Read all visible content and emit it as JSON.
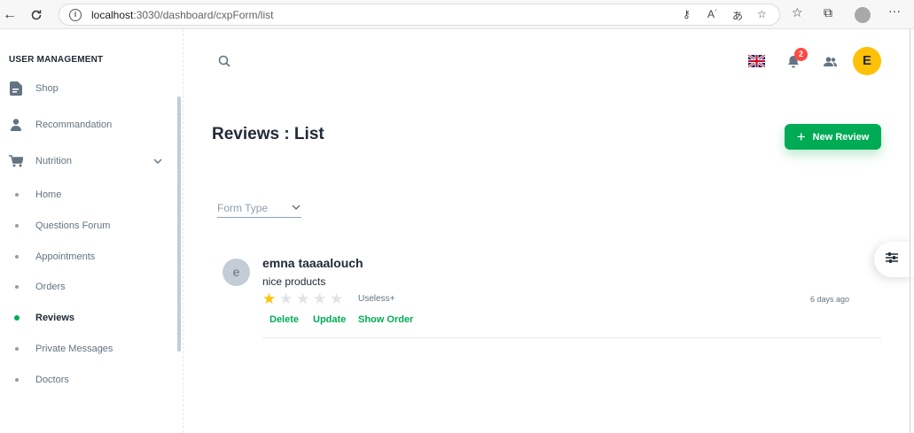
{
  "browser": {
    "url_host": "localhost",
    "url_path": ":3030/dashboard/cxpForm/list",
    "read_aloud_icon": "read-aloud-icon",
    "translate_icon": "translate-icon"
  },
  "sidebar": {
    "header": "USER MANAGEMENT",
    "items": [
      {
        "label": "Shop",
        "icon": "file-icon"
      },
      {
        "label": "Recommandation",
        "icon": "person-icon"
      },
      {
        "label": "Nutrition",
        "icon": "cart-icon"
      }
    ],
    "subitems": [
      {
        "label": "Home"
      },
      {
        "label": "Questions Forum"
      },
      {
        "label": "Appointments"
      },
      {
        "label": "Orders"
      },
      {
        "label": "Reviews",
        "active": true
      },
      {
        "label": "Private Messages"
      },
      {
        "label": "Doctors"
      }
    ]
  },
  "topbar": {
    "notification_count": "2",
    "avatar_letter": "E"
  },
  "page": {
    "title": "Reviews : List",
    "new_button": "New Review",
    "filter_label": "Form Type"
  },
  "review": {
    "avatar_letter": "e",
    "author": "emna taaaalouch",
    "text": "nice products",
    "rating": 1,
    "rating_max": 5,
    "rating_label": "Useless+",
    "time": "6 days ago",
    "actions": {
      "delete": "Delete",
      "update": "Update",
      "show_order": "Show Order"
    }
  },
  "colors": {
    "primary": "#00ab55",
    "star": "#ffc107",
    "badge": "#ff4842",
    "avatar": "#ffc107"
  }
}
